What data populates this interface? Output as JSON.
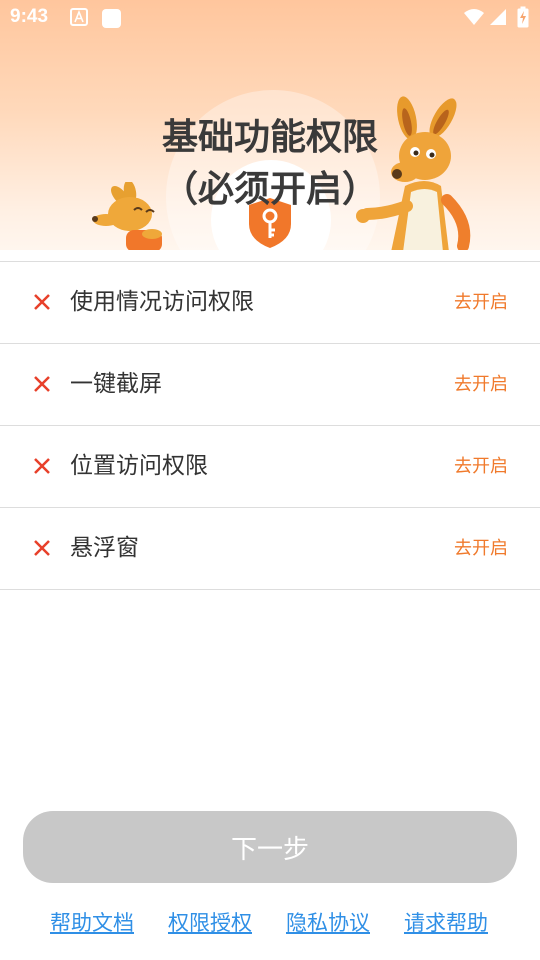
{
  "status_bar": {
    "time": "9:43"
  },
  "header": {
    "title_line1": "基础功能权限",
    "title_line2": "（必须开启）"
  },
  "permissions": [
    {
      "label": "使用情况访问权限",
      "action": "去开启"
    },
    {
      "label": "一键截屏",
      "action": "去开启"
    },
    {
      "label": "位置访问权限",
      "action": "去开启"
    },
    {
      "label": "悬浮窗",
      "action": "去开启"
    }
  ],
  "next_button": {
    "label": "下一步"
  },
  "footer_links": [
    "帮助文档",
    "权限授权",
    "隐私协议",
    "请求帮助"
  ],
  "colors": {
    "accent": "#f07a2c",
    "denied_icon": "#e8402a",
    "link": "#2f8fe6",
    "disabled_button": "#c8c8c8"
  }
}
